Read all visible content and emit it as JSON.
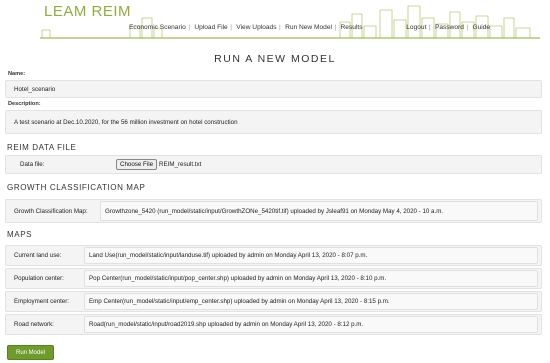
{
  "app": {
    "logo_text": "LEAM REIM"
  },
  "nav": {
    "items": [
      "Economic Scenario",
      "Upload File",
      "View Uploads",
      "Run New Model",
      "Results"
    ],
    "right_items": [
      "Logout",
      "Password",
      "Guide"
    ]
  },
  "page": {
    "title": "RUN A NEW MODEL"
  },
  "form": {
    "name_label": "Name:",
    "name_value": "Hotel_scenario",
    "description_label": "Description:",
    "description_value": "A test scenario at Dec.10.2020, for the 56 million investment on hotel construction"
  },
  "reim_file": {
    "heading": "REIM DATA FILE",
    "label": "Data file:",
    "button_label": "Choose File",
    "file_name": "REIM_result.txt"
  },
  "growth": {
    "heading": "GROWTH CLASSIFICATION MAP",
    "label": "Growth Classification Map:",
    "value": "Growthzone_5420 (run_model/static/input/GrowthZONe_5420tif.tif) uploaded by Jsleaf91 on Monday May 4, 2020 - 10 a.m."
  },
  "maps": {
    "heading": "MAPS",
    "rows": [
      {
        "label": "Current land use:",
        "value": "Land Use(run_model/static/input/landuse.tif) uploaded by admin on Monday April 13, 2020 - 8:07 p.m."
      },
      {
        "label": "Population center:",
        "value": "Pop Center(run_model/static/input/pop_center.shp) uploaded by admin on Monday April 13, 2020 - 8:10 p.m."
      },
      {
        "label": "Employment center:",
        "value": "Emp Center(run_model/static/input/emp_center.shp) uploaded by admin on Monday April 13, 2020 - 8:15 p.m."
      },
      {
        "label": "Road network:",
        "value": "Road(run_model/static/input/road2019.shp uploaded by admin on Monday April 13, 2020 - 8:12 p.m."
      }
    ]
  },
  "actions": {
    "run_label": "Run Model"
  },
  "colors": {
    "brand": "#8fae3d",
    "button": "#6f9a2c"
  }
}
